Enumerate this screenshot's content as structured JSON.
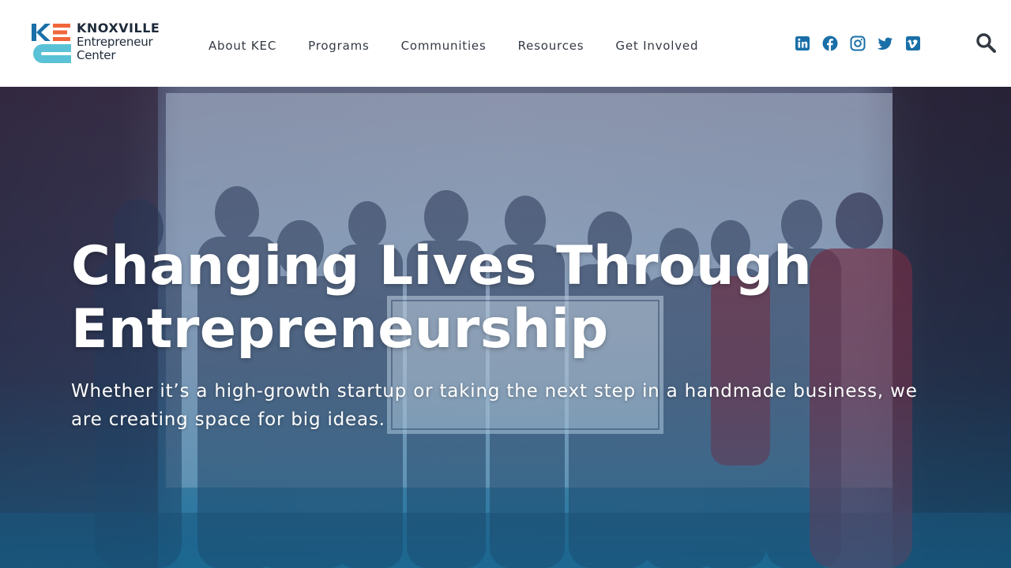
{
  "logo": {
    "line1": "KNOXVILLE",
    "line2": "Entrepreneur",
    "line3": "Center",
    "mark_letters": "KE",
    "colors": {
      "k": "#1a6fa8",
      "e": "#f0663a",
      "c": "#59c2d6"
    }
  },
  "nav": {
    "items": [
      {
        "label": "About KEC"
      },
      {
        "label": "Programs"
      },
      {
        "label": "Communities"
      },
      {
        "label": "Resources"
      },
      {
        "label": "Get Involved"
      }
    ]
  },
  "social": {
    "color": "#1a6fa8",
    "icons": [
      "linkedin-icon",
      "facebook-icon",
      "instagram-icon",
      "twitter-icon",
      "vimeo-icon"
    ]
  },
  "search": {
    "icon": "search-icon",
    "color": "#333a44"
  },
  "hero": {
    "title": "Changing Lives Through Entrepreneurship",
    "subtitle": "Whether it’s a high-growth startup or taking the next step in a handmade business, we are creating space for big ideas.",
    "overlay_color": "#0e6e9a"
  }
}
